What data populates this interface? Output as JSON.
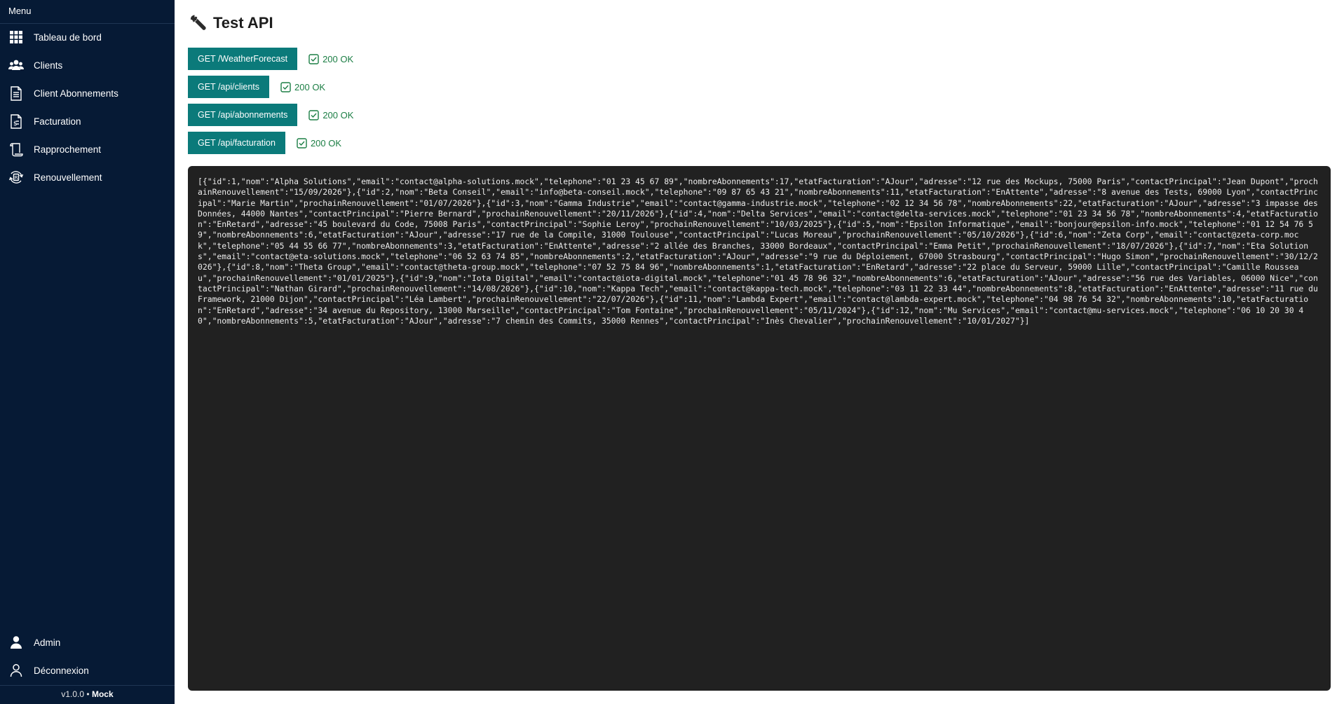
{
  "sidebar": {
    "menu_title": "Menu",
    "items": [
      {
        "label": "Tableau de bord",
        "icon": "grid-icon"
      },
      {
        "label": "Clients",
        "icon": "users-icon"
      },
      {
        "label": "Client Abonnements",
        "icon": "document-list-icon"
      },
      {
        "label": "Facturation",
        "icon": "invoice-icon"
      },
      {
        "label": "Rapprochement",
        "icon": "receipt-icon"
      },
      {
        "label": "Renouvellement",
        "icon": "renew-icon"
      }
    ],
    "bottom_items": [
      {
        "label": "Admin",
        "icon": "user-icon"
      },
      {
        "label": "Déconnexion",
        "icon": "user-outline-icon"
      }
    ],
    "version": "v1.0.0",
    "version_separator": "•",
    "mode": "Mock"
  },
  "page": {
    "title": "Test API",
    "title_icon": "wrench-icon"
  },
  "api_tests": [
    {
      "label": "GET /WeatherForecast",
      "status": "200 OK"
    },
    {
      "label": "GET /api/clients",
      "status": "200 OK"
    },
    {
      "label": "GET /api/abonnements",
      "status": "200 OK"
    },
    {
      "label": "GET /api/facturation",
      "status": "200 OK"
    }
  ],
  "colors": {
    "sidebar_bg": "#061a35",
    "button_bg": "#0b7a7a",
    "status_ok": "#1b7e44",
    "panel_bg": "#212121"
  },
  "response_output": "[{\"id\":1,\"nom\":\"Alpha Solutions\",\"email\":\"contact@alpha-solutions.mock\",\"telephone\":\"01 23 45 67 89\",\"nombreAbonnements\":17,\"etatFacturation\":\"AJour\",\"adresse\":\"12 rue des Mockups, 75000 Paris\",\"contactPrincipal\":\"Jean Dupont\",\"prochainRenouvellement\":\"15/09/2026\"},{\"id\":2,\"nom\":\"Beta Conseil\",\"email\":\"info@beta-conseil.mock\",\"telephone\":\"09 87 65 43 21\",\"nombreAbonnements\":11,\"etatFacturation\":\"EnAttente\",\"adresse\":\"8 avenue des Tests, 69000 Lyon\",\"contactPrincipal\":\"Marie Martin\",\"prochainRenouvellement\":\"01/07/2026\"},{\"id\":3,\"nom\":\"Gamma Industrie\",\"email\":\"contact@gamma-industrie.mock\",\"telephone\":\"02 12 34 56 78\",\"nombreAbonnements\":22,\"etatFacturation\":\"AJour\",\"adresse\":\"3 impasse des Données, 44000 Nantes\",\"contactPrincipal\":\"Pierre Bernard\",\"prochainRenouvellement\":\"20/11/2026\"},{\"id\":4,\"nom\":\"Delta Services\",\"email\":\"contact@delta-services.mock\",\"telephone\":\"01 23 34 56 78\",\"nombreAbonnements\":4,\"etatFacturation\":\"EnRetard\",\"adresse\":\"45 boulevard du Code, 75008 Paris\",\"contactPrincipal\":\"Sophie Leroy\",\"prochainRenouvellement\":\"10/03/2025\"},{\"id\":5,\"nom\":\"Epsilon Informatique\",\"email\":\"bonjour@epsilon-info.mock\",\"telephone\":\"01 12 54 76 59\",\"nombreAbonnements\":6,\"etatFacturation\":\"AJour\",\"adresse\":\"17 rue de la Compile, 31000 Toulouse\",\"contactPrincipal\":\"Lucas Moreau\",\"prochainRenouvellement\":\"05/10/2026\"},{\"id\":6,\"nom\":\"Zeta Corp\",\"email\":\"contact@zeta-corp.mock\",\"telephone\":\"05 44 55 66 77\",\"nombreAbonnements\":3,\"etatFacturation\":\"EnAttente\",\"adresse\":\"2 allée des Branches, 33000 Bordeaux\",\"contactPrincipal\":\"Emma Petit\",\"prochainRenouvellement\":\"18/07/2026\"},{\"id\":7,\"nom\":\"Eta Solutions\",\"email\":\"contact@eta-solutions.mock\",\"telephone\":\"06 52 63 74 85\",\"nombreAbonnements\":2,\"etatFacturation\":\"AJour\",\"adresse\":\"9 rue du Déploiement, 67000 Strasbourg\",\"contactPrincipal\":\"Hugo Simon\",\"prochainRenouvellement\":\"30/12/2026\"},{\"id\":8,\"nom\":\"Theta Group\",\"email\":\"contact@theta-group.mock\",\"telephone\":\"07 52 75 84 96\",\"nombreAbonnements\":1,\"etatFacturation\":\"EnRetard\",\"adresse\":\"22 place du Serveur, 59000 Lille\",\"contactPrincipal\":\"Camille Rousseau\",\"prochainRenouvellement\":\"01/01/2025\"},{\"id\":9,\"nom\":\"Iota Digital\",\"email\":\"contact@iota-digital.mock\",\"telephone\":\"01 45 78 96 32\",\"nombreAbonnements\":6,\"etatFacturation\":\"AJour\",\"adresse\":\"56 rue des Variables, 06000 Nice\",\"contactPrincipal\":\"Nathan Girard\",\"prochainRenouvellement\":\"14/08/2026\"},{\"id\":10,\"nom\":\"Kappa Tech\",\"email\":\"contact@kappa-tech.mock\",\"telephone\":\"03 11 22 33 44\",\"nombreAbonnements\":8,\"etatFacturation\":\"EnAttente\",\"adresse\":\"11 rue du Framework, 21000 Dijon\",\"contactPrincipal\":\"Léa Lambert\",\"prochainRenouvellement\":\"22/07/2026\"},{\"id\":11,\"nom\":\"Lambda Expert\",\"email\":\"contact@lambda-expert.mock\",\"telephone\":\"04 98 76 54 32\",\"nombreAbonnements\":10,\"etatFacturation\":\"EnRetard\",\"adresse\":\"34 avenue du Repository, 13000 Marseille\",\"contactPrincipal\":\"Tom Fontaine\",\"prochainRenouvellement\":\"05/11/2024\"},{\"id\":12,\"nom\":\"Mu Services\",\"email\":\"contact@mu-services.mock\",\"telephone\":\"06 10 20 30 40\",\"nombreAbonnements\":5,\"etatFacturation\":\"AJour\",\"adresse\":\"7 chemin des Commits, 35000 Rennes\",\"contactPrincipal\":\"Inès Chevalier\",\"prochainRenouvellement\":\"10/01/2027\"}]"
}
